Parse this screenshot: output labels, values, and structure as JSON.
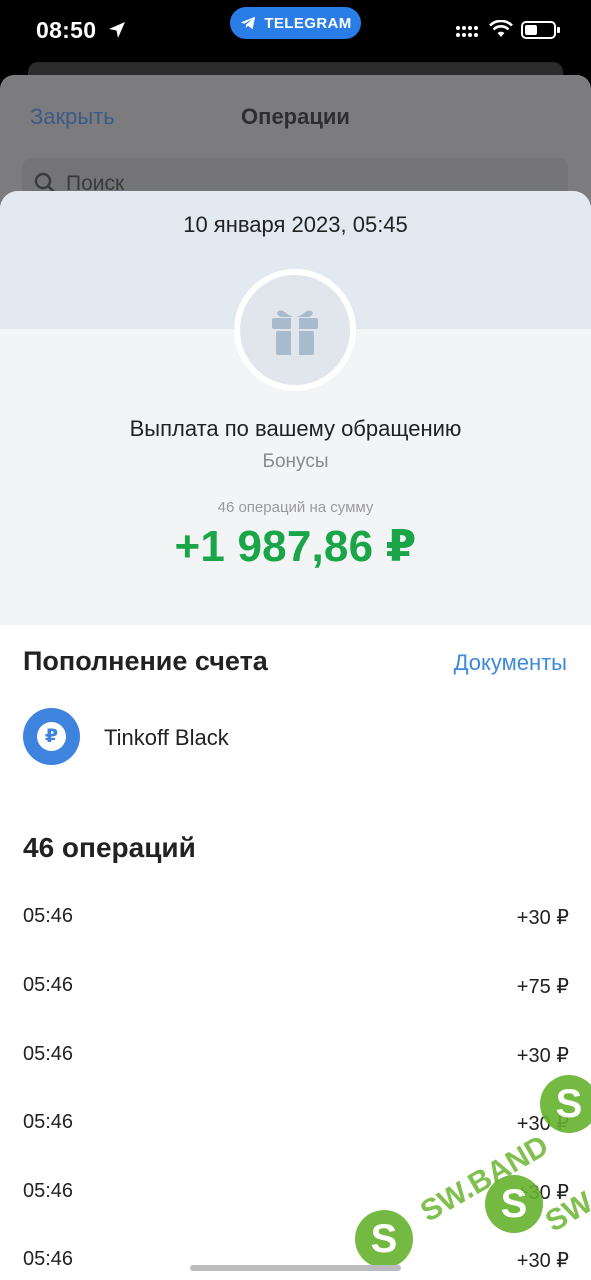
{
  "status_bar": {
    "time": "08:50",
    "app_pill": "TELEGRAM"
  },
  "background_screen": {
    "close_label": "Закрыть",
    "title": "Операции",
    "search_placeholder": "Поиск"
  },
  "sheet": {
    "date": "10 января 2023, 05:45",
    "operation_title": "Выплата по вашему обращению",
    "category": "Бонусы",
    "count_label": "46 операций на сумму",
    "total": "+1 987,86 ₽",
    "icon": "gift-icon"
  },
  "account_section": {
    "title": "Пополнение счета",
    "documents_link": "Документы",
    "account_icon_symbol": "₽",
    "account_name": "Tinkoff Black"
  },
  "operations": {
    "title": "46 операций",
    "rows": [
      {
        "time": "05:46",
        "amount": "+30 ₽"
      },
      {
        "time": "05:46",
        "amount": "+75 ₽"
      },
      {
        "time": "05:46",
        "amount": "+30 ₽"
      },
      {
        "time": "05:46",
        "amount": "+30 ₽"
      },
      {
        "time": "05:46",
        "amount": "+30 ₽"
      },
      {
        "time": "05:46",
        "amount": "+30 ₽"
      }
    ]
  },
  "watermark": {
    "logo_letter": "S",
    "text": "SW.BAND"
  },
  "colors": {
    "accent_blue": "#3d8ad9",
    "positive_green": "#19a548",
    "telegram_blue": "#2a7ce6"
  }
}
